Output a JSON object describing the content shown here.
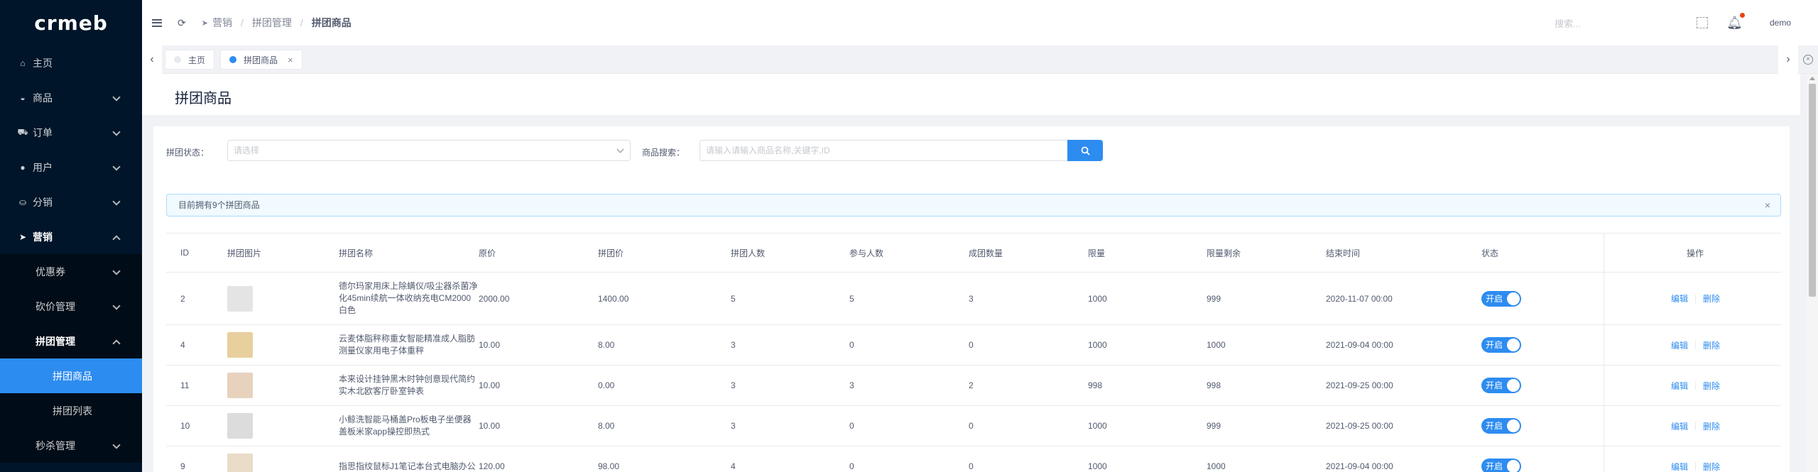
{
  "app": {
    "logo": "crmeb"
  },
  "sidebar": {
    "items": [
      {
        "label": "主页",
        "icon": "home-icon"
      },
      {
        "label": "商品",
        "icon": "shopping-basket-icon"
      },
      {
        "label": "订单",
        "icon": "cart-icon"
      },
      {
        "label": "用户",
        "icon": "user-icon"
      },
      {
        "label": "分销",
        "icon": "distribution-icon"
      },
      {
        "label": "营销",
        "icon": "send-icon"
      }
    ],
    "marketing_children": [
      {
        "label": "优惠券"
      },
      {
        "label": "砍价管理"
      },
      {
        "label": "拼团管理"
      }
    ],
    "group_children": [
      {
        "label": "拼团商品"
      },
      {
        "label": "拼团列表"
      }
    ],
    "flash_sale": {
      "label": "秒杀管理"
    }
  },
  "header": {
    "breadcrumb": [
      "营销",
      "拼团管理",
      "拼团商品"
    ],
    "search_placeholder": "搜索...",
    "username": "demo"
  },
  "tabs": [
    {
      "label": "主页"
    },
    {
      "label": "拼团商品"
    }
  ],
  "page": {
    "title": "拼团商品"
  },
  "filters": {
    "status_label": "拼团状态：",
    "status_placeholder": "请选择",
    "search_label": "商品搜索：",
    "search_placeholder": "请输入请输入商品名称,关键字,ID"
  },
  "alert": {
    "text": "目前拥有9个拼团商品"
  },
  "table": {
    "columns": [
      "ID",
      "拼团图片",
      "拼团名称",
      "原价",
      "拼团价",
      "拼团人数",
      "参与人数",
      "成团数量",
      "限量",
      "限量剩余",
      "结束时间",
      "状态",
      "操作"
    ],
    "status_on": "开启",
    "edit_label": "编辑",
    "delete_label": "删除",
    "rows": [
      {
        "id": "2",
        "name": "德尔玛家用床上除螨仪/吸尘器杀菌净化45min续航一体收纳充电CM2000白色",
        "price": "2000.00",
        "group_price": "1400.00",
        "group_size": "5",
        "participants": "5",
        "groups_formed": "3",
        "limit": "1000",
        "remaining": "999",
        "end_time": "2020-11-07 00:00",
        "img_color": "#e4e4e4"
      },
      {
        "id": "4",
        "name": "云麦体脂秤称重女智能精准成人脂肪测量仪家用电子体重秤",
        "price": "10.00",
        "group_price": "8.00",
        "group_size": "3",
        "participants": "0",
        "groups_formed": "0",
        "limit": "1000",
        "remaining": "1000",
        "end_time": "2021-09-04 00:00",
        "img_color": "#e8cf9e"
      },
      {
        "id": "11",
        "name": "本来设计挂钟黑木时钟创意现代简约实木北欧客厅卧室钟表",
        "price": "10.00",
        "group_price": "0.00",
        "group_size": "3",
        "participants": "3",
        "groups_formed": "2",
        "limit": "998",
        "remaining": "998",
        "end_time": "2021-09-25 00:00",
        "img_color": "#e6d2bd"
      },
      {
        "id": "10",
        "name": "小鲸洗智能马桶盖Pro板电子坐便器盖板米家app操控即热式",
        "price": "10.00",
        "group_price": "8.00",
        "group_size": "3",
        "participants": "0",
        "groups_formed": "0",
        "limit": "1000",
        "remaining": "999",
        "end_time": "2021-09-25 00:00",
        "img_color": "#dcdcdc"
      },
      {
        "id": "9",
        "name": "指思指纹鼠标J1笔记本台式电脑办公",
        "price": "120.00",
        "group_price": "98.00",
        "group_size": "4",
        "participants": "0",
        "groups_formed": "0",
        "limit": "1000",
        "remaining": "1000",
        "end_time": "2021-09-04 00:00",
        "img_color": "#e9dcc8"
      }
    ]
  },
  "colors": {
    "primary": "#2d8cf0",
    "sidebar_bg": "#001529",
    "danger_dot": "#ed4014"
  }
}
